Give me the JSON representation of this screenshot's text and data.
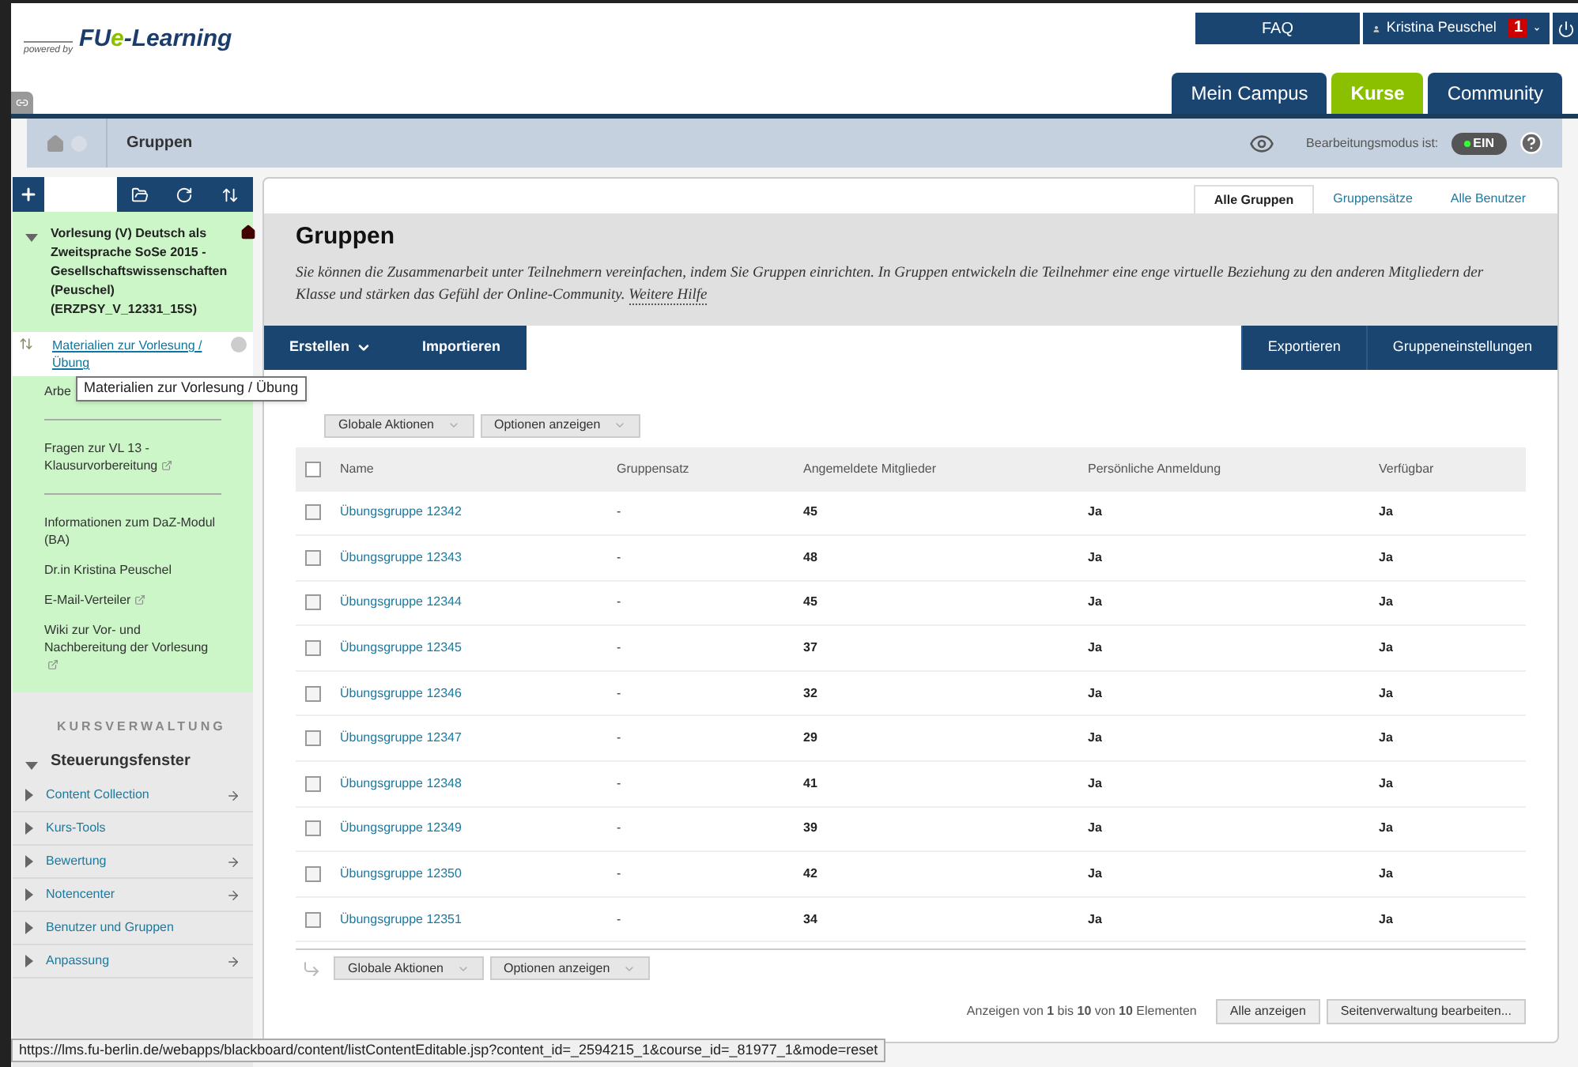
{
  "logo": {
    "prefix": "powered by",
    "brand_a": "FU",
    "brand_b": "e",
    "brand_c": "-Learning"
  },
  "top_links": {
    "faq": "FAQ",
    "user": "Kristina Peuschel",
    "notifications": "1"
  },
  "main_tabs": [
    {
      "label": "Mein Campus",
      "selected": false
    },
    {
      "label": "Kurse",
      "selected": true
    },
    {
      "label": "Community",
      "selected": false
    }
  ],
  "breadcrumb": {
    "current": "Gruppen"
  },
  "edit_mode": {
    "label": "Bearbeitungsmodus ist:",
    "toggle": "EIN",
    "on": true
  },
  "course_menu": {
    "title": "Vorlesung (V) Deutsch als Zweitsprache SoSe 2015 - Gesellschaftswissenschaften (Peuschel) (ERZPSY_V_12331_15S)",
    "expanded": true,
    "items": [
      {
        "kind": "link",
        "label": "Materialien zur Vorlesung / Übung",
        "selected": true,
        "external": false
      },
      {
        "kind": "link",
        "label": "Arbe",
        "selected": false,
        "external": false
      },
      {
        "kind": "divider"
      },
      {
        "kind": "link",
        "label": "Fragen zur VL 13 - Klausurvorbereitung",
        "selected": false,
        "external": true
      },
      {
        "kind": "divider"
      },
      {
        "kind": "link",
        "label": "Informationen zum DaZ-Modul (BA)",
        "selected": false,
        "external": false
      },
      {
        "kind": "link",
        "label": "Dr.in Kristina Peuschel",
        "selected": false,
        "external": false
      },
      {
        "kind": "link",
        "label": "E-Mail-Verteiler",
        "selected": false,
        "external": true
      },
      {
        "kind": "link",
        "label": "Wiki zur Vor- und Nachbereitung der Vorlesung",
        "selected": false,
        "external": true
      }
    ],
    "tooltip": "Materialien zur Vorlesung / Übung"
  },
  "course_admin": {
    "heading": "KURSVERWALTUNG",
    "panel": "Steuerungsfenster",
    "expanded": true,
    "items": [
      {
        "label": "Content Collection",
        "arrow": true
      },
      {
        "label": "Kurs-Tools",
        "arrow": false
      },
      {
        "label": "Bewertung",
        "arrow": true
      },
      {
        "label": "Notencenter",
        "arrow": true
      },
      {
        "label": "Benutzer und Gruppen",
        "arrow": false
      },
      {
        "label": "Anpassung",
        "arrow": true
      }
    ]
  },
  "sub_tabs": [
    {
      "label": "Alle Gruppen",
      "selected": true
    },
    {
      "label": "Gruppensätze",
      "selected": false
    },
    {
      "label": "Alle Benutzer",
      "selected": false
    }
  ],
  "page": {
    "title": "Gruppen",
    "description": "Sie können die Zusammenarbeit unter Teilnehmern vereinfachen, indem Sie Gruppen einrichten. In Gruppen entwickeln die Teilnehmer eine enge virtuelle Beziehung zu den anderen Mitgliedern der Klasse und stärken das Gefühl der Online-Community.",
    "help_link": "Weitere Hilfe"
  },
  "action_bar": {
    "left": [
      {
        "label": "Erstellen",
        "dropdown": true
      },
      {
        "label": "Importieren",
        "dropdown": false
      }
    ],
    "right": [
      "Exportieren",
      "Gruppeneinstellungen"
    ]
  },
  "list_actions": [
    "Globale Aktionen",
    "Optionen anzeigen"
  ],
  "list_actions_bottom": [
    "Globale Aktionen",
    "Optionen anzeigen"
  ],
  "table": {
    "select_all_checked": false,
    "columns": [
      "Name",
      "Gruppensatz",
      "Angemeldete Mitglieder",
      "Persönliche Anmeldung",
      "Verfügbar"
    ],
    "rows": [
      {
        "name": "Übungsgruppe 12342",
        "set": "-",
        "members": "45",
        "signup": "Ja",
        "available": "Ja",
        "checked": false
      },
      {
        "name": "Übungsgruppe 12343",
        "set": "-",
        "members": "48",
        "signup": "Ja",
        "available": "Ja",
        "checked": false
      },
      {
        "name": "Übungsgruppe 12344",
        "set": "-",
        "members": "45",
        "signup": "Ja",
        "available": "Ja",
        "checked": false
      },
      {
        "name": "Übungsgruppe 12345",
        "set": "-",
        "members": "37",
        "signup": "Ja",
        "available": "Ja",
        "checked": false
      },
      {
        "name": "Übungsgruppe 12346",
        "set": "-",
        "members": "32",
        "signup": "Ja",
        "available": "Ja",
        "checked": false
      },
      {
        "name": "Übungsgruppe 12347",
        "set": "-",
        "members": "29",
        "signup": "Ja",
        "available": "Ja",
        "checked": false
      },
      {
        "name": "Übungsgruppe 12348",
        "set": "-",
        "members": "41",
        "signup": "Ja",
        "available": "Ja",
        "checked": false
      },
      {
        "name": "Übungsgruppe 12349",
        "set": "-",
        "members": "39",
        "signup": "Ja",
        "available": "Ja",
        "checked": false
      },
      {
        "name": "Übungsgruppe 12350",
        "set": "-",
        "members": "42",
        "signup": "Ja",
        "available": "Ja",
        "checked": false
      },
      {
        "name": "Übungsgruppe 12351",
        "set": "-",
        "members": "34",
        "signup": "Ja",
        "available": "Ja",
        "checked": false
      }
    ]
  },
  "pagination": {
    "summary": "Anzeigen von **1** bis **10** von **10** Elementen",
    "buttons": [
      "Alle anzeigen",
      "Seitenverwaltung bearbeiten..."
    ]
  },
  "status_bar": {
    "url": "https://lms.fu-berlin.de/webapps/blackboard/content/listContentEditable.jsp?content_id=_2594215_1&course_id=_81977_1&mode=reset"
  }
}
